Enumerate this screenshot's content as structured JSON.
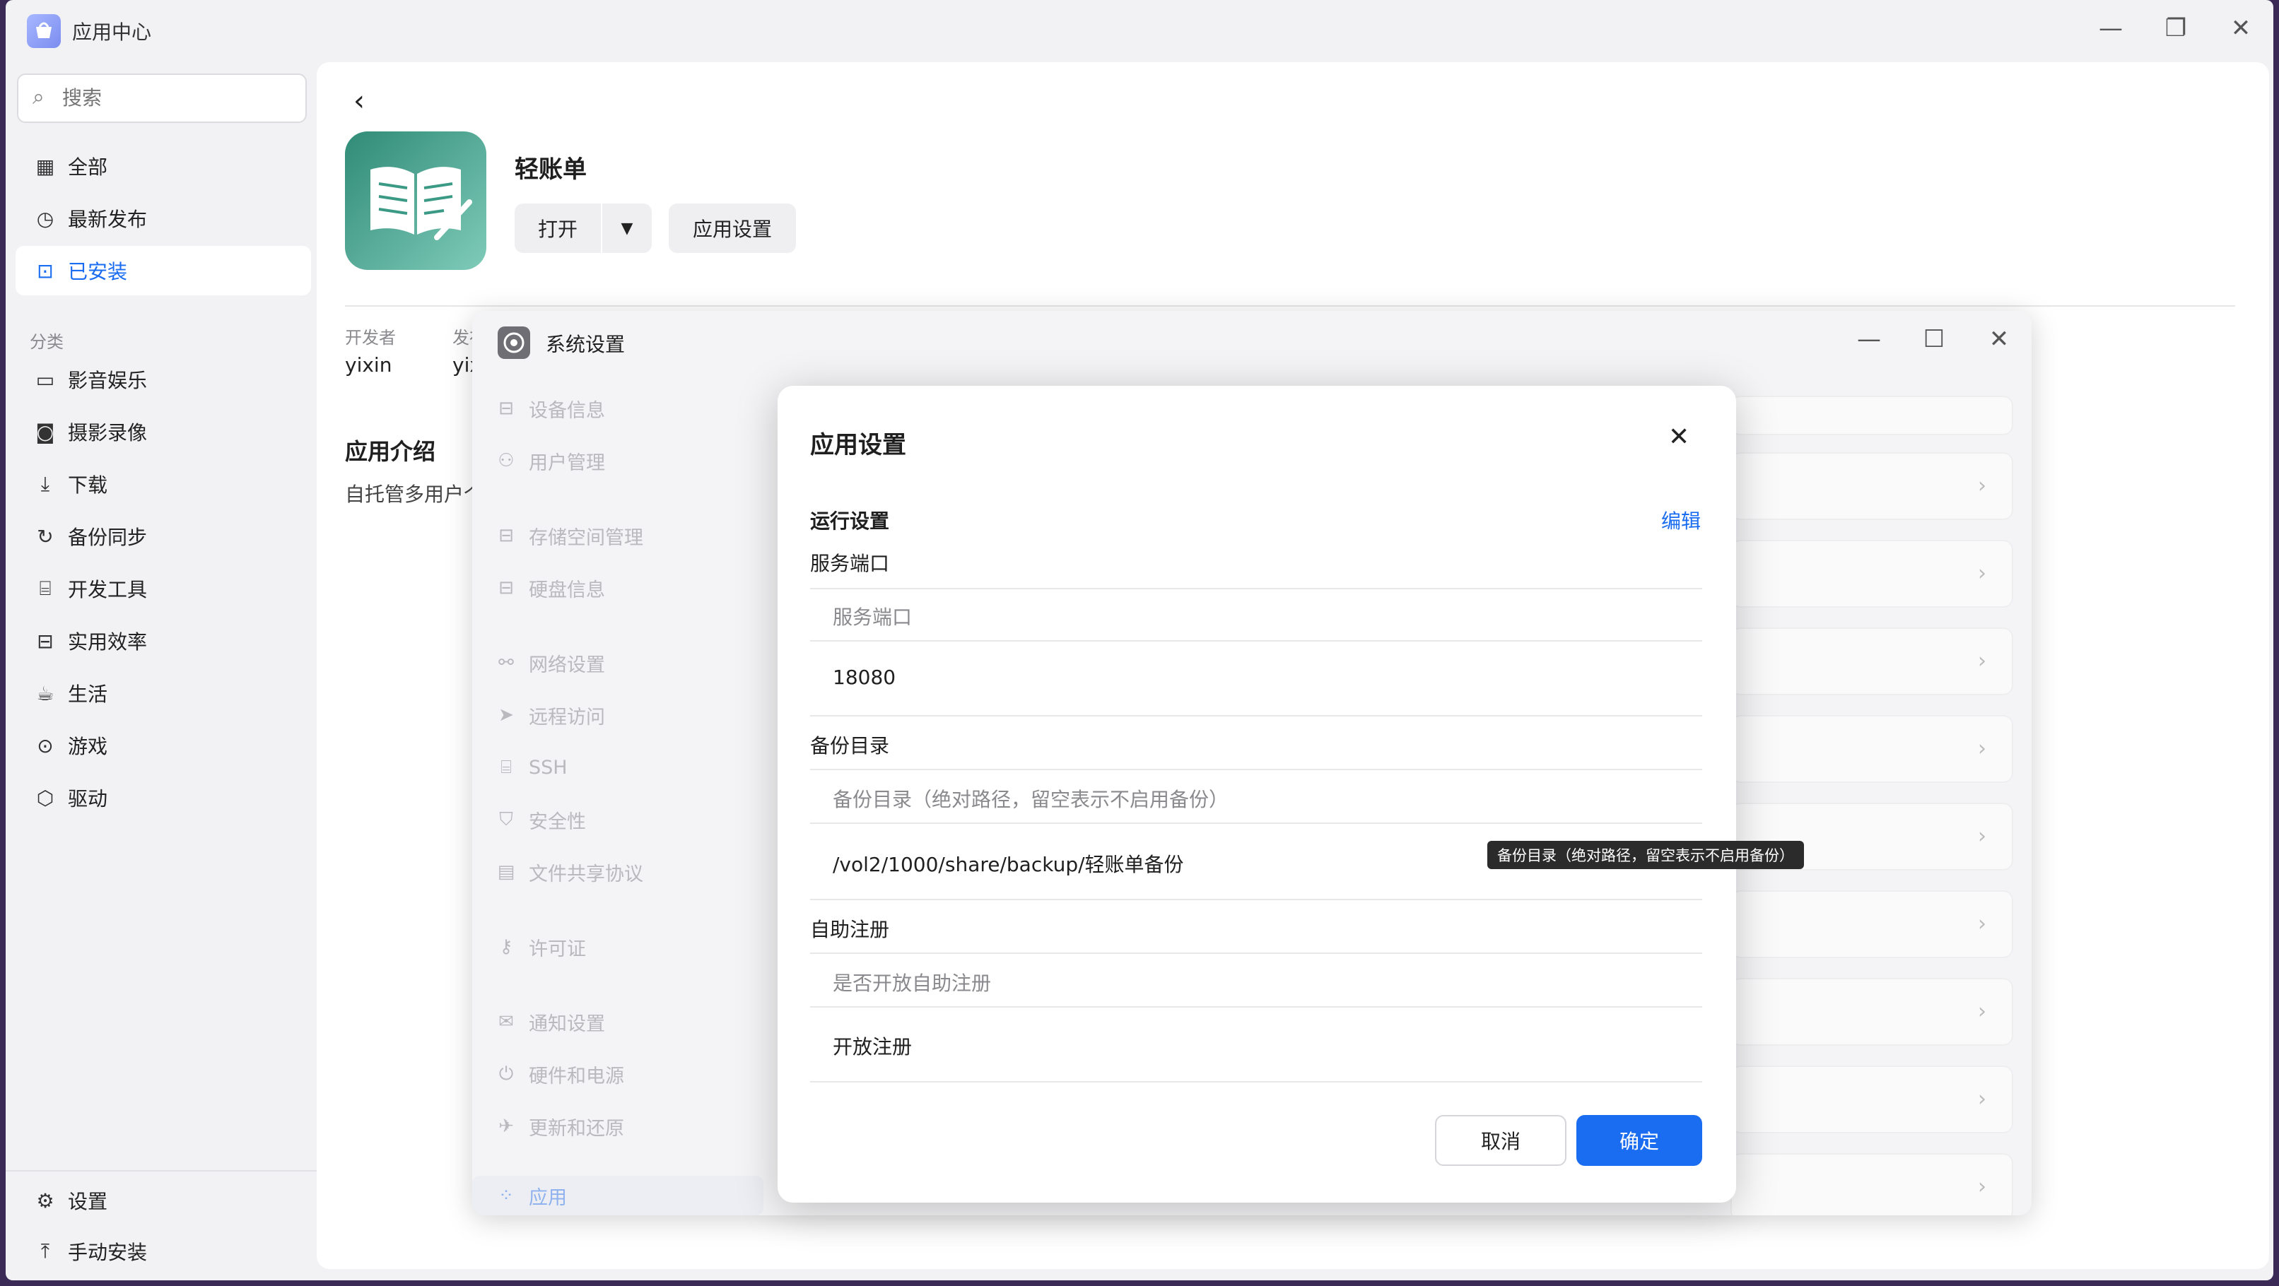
{
  "app": {
    "title": "应用中心"
  },
  "sidebar": {
    "search_placeholder": "搜索",
    "items": [
      {
        "icon": "grid-icon",
        "label": "全部"
      },
      {
        "icon": "clock-icon",
        "label": "最新发布"
      },
      {
        "icon": "installed-icon",
        "label": "已安装"
      }
    ],
    "category_heading": "分类",
    "categories": [
      {
        "icon": "video-icon",
        "label": "影音娱乐"
      },
      {
        "icon": "camera-icon",
        "label": "摄影录像"
      },
      {
        "icon": "download-icon",
        "label": "下载"
      },
      {
        "icon": "sync-icon",
        "label": "备份同步"
      },
      {
        "icon": "code-icon",
        "label": "开发工具"
      },
      {
        "icon": "briefcase-icon",
        "label": "实用效率"
      },
      {
        "icon": "cup-icon",
        "label": "生活"
      },
      {
        "icon": "gamepad-icon",
        "label": "游戏"
      },
      {
        "icon": "cube-icon",
        "label": "驱动"
      }
    ],
    "footer": [
      {
        "icon": "gear-icon",
        "label": "设置"
      },
      {
        "icon": "upload-icon",
        "label": "手动安装"
      }
    ]
  },
  "app_detail": {
    "name": "轻账单",
    "open_label": "打开",
    "settings_label": "应用设置",
    "developer_label": "开发者",
    "developer_value": "yixin",
    "publisher_label": "发布",
    "publisher_value": "yix",
    "intro_heading": "应用介绍",
    "intro_text": "自托管多用户个"
  },
  "system_settings": {
    "title": "系统设置",
    "menu": [
      {
        "icon": "drive-icon",
        "label": "设备信息"
      },
      {
        "icon": "users-icon",
        "label": "用户管理"
      },
      {
        "icon": "storage-icon",
        "label": "存储空间管理"
      },
      {
        "icon": "disk-icon",
        "label": "硬盘信息"
      },
      {
        "icon": "network-icon",
        "label": "网络设置"
      },
      {
        "icon": "send-icon",
        "label": "远程访问"
      },
      {
        "icon": "terminal-icon",
        "label": "SSH"
      },
      {
        "icon": "shield-icon",
        "label": "安全性"
      },
      {
        "icon": "file-icon",
        "label": "文件共享协议"
      },
      {
        "icon": "key-icon",
        "label": "许可证"
      },
      {
        "icon": "mail-icon",
        "label": "通知设置"
      },
      {
        "icon": "power-icon",
        "label": "硬件和电源"
      },
      {
        "icon": "rocket-icon",
        "label": "更新和还原"
      },
      {
        "icon": "apps-icon",
        "label": "应用"
      }
    ]
  },
  "dialog": {
    "title": "应用设置",
    "section": "运行设置",
    "edit_label": "编辑",
    "groups": [
      {
        "heading": "服务端口",
        "field_label": "服务端口",
        "value": "18080"
      },
      {
        "heading": "备份目录",
        "field_label": "备份目录（绝对路径，留空表示不启用备份）",
        "value": "/vol2/1000/share/backup/轻账单备份"
      },
      {
        "heading": "自助注册",
        "field_label": "是否开放自助注册",
        "value": "开放注册"
      }
    ],
    "cancel_label": "取消",
    "confirm_label": "确定",
    "tooltip": "备份目录（绝对路径，留空表示不启用备份）"
  },
  "colors": {
    "accent": "#1a6cf0",
    "app_icon_bg": "#3a9a85"
  }
}
